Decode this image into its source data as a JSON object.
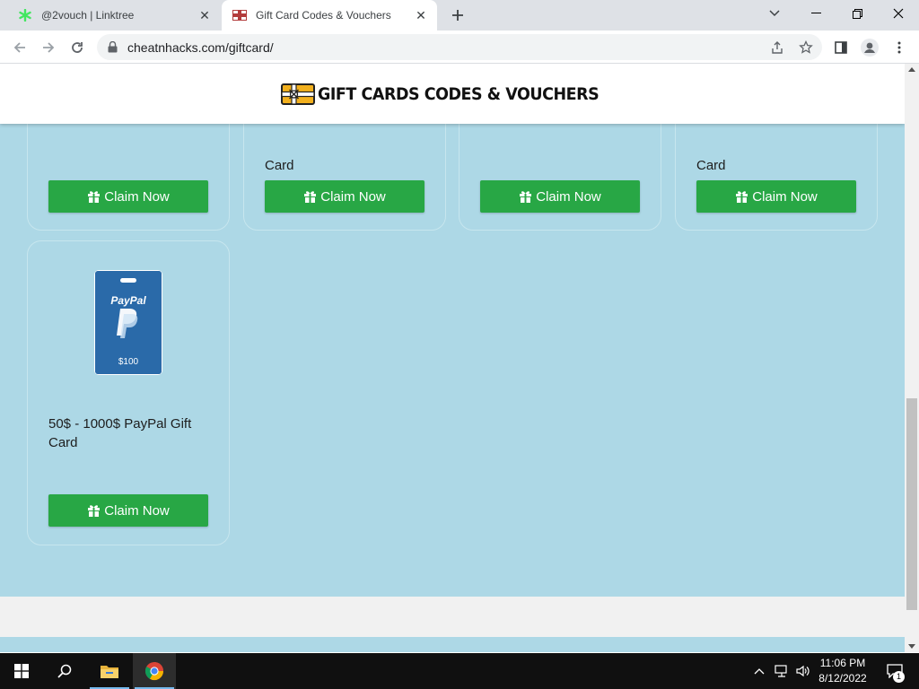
{
  "browser": {
    "tabs": [
      {
        "title": "@2vouch | Linktree",
        "active": false
      },
      {
        "title": "Gift Card Codes & Vouchers",
        "active": true
      }
    ],
    "url": "cheatnhacks.com/giftcard/"
  },
  "site": {
    "logo_text": "GIFT CARDS CODES & VOUCHERS",
    "accent_color": "#28a745",
    "background_color": "#add8e6",
    "cards_top_row": [
      {
        "title_tail": ""
      },
      {
        "title_tail": "Card"
      },
      {
        "title_tail": ""
      },
      {
        "title_tail": "Card"
      }
    ],
    "claim_label": "Claim Now",
    "paypal_card": {
      "brand": "PayPal",
      "amount": "$100",
      "title": "50$ - 1000$ PayPal Gift Card"
    }
  },
  "taskbar": {
    "time": "11:06 PM",
    "date": "8/12/2022",
    "notification_count": "1"
  }
}
